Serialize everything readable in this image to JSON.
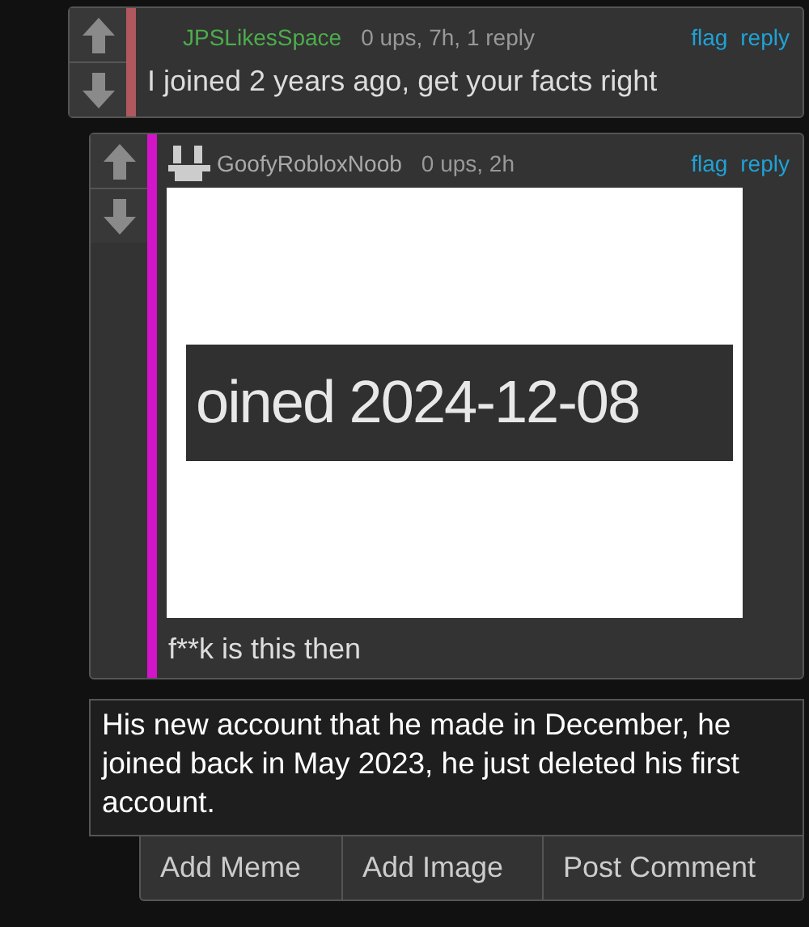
{
  "comments": [
    {
      "username": "JPSLikesSpace",
      "kind": "named",
      "meta": "0 ups, 7h, 1 reply",
      "actions": [
        "flag",
        "reply"
      ],
      "color": "#b0585e",
      "body": "I joined 2 years ago, get your facts right"
    },
    {
      "username": "GoofyRobloxNoob",
      "kind": "avatar",
      "meta": "0 ups, 2h",
      "actions": [
        "flag",
        "reply"
      ],
      "color": "#d414c8",
      "image": {
        "kind": "screenshot",
        "text": "oined 2024-12-08"
      },
      "body": "f**k is this then"
    }
  ],
  "reply_box": {
    "value": "His new account that he made in December, he joined back in May 2023, he just deleted his first account."
  },
  "buttons": [
    "Add Meme",
    "Add Image",
    "Post Comment"
  ]
}
